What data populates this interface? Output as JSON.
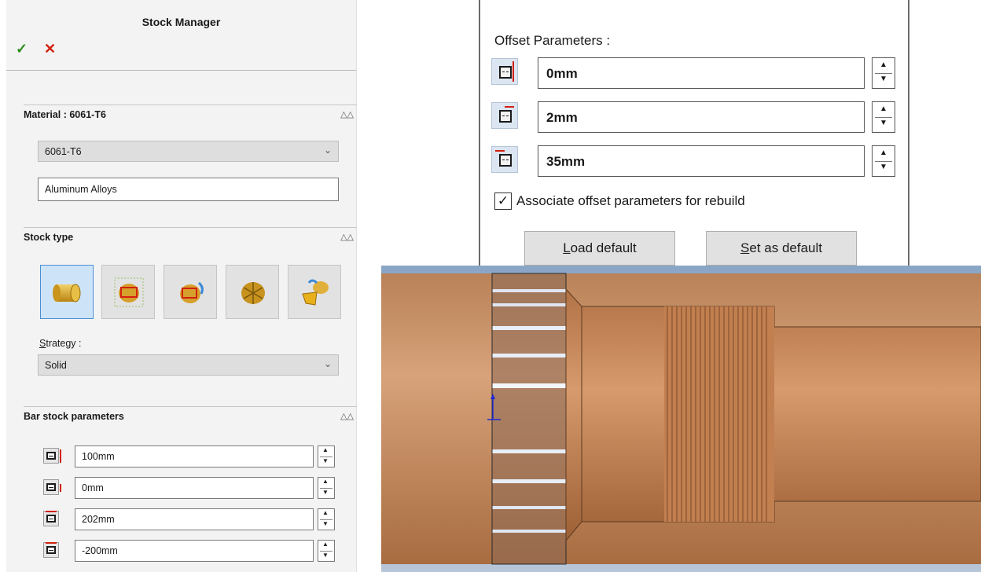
{
  "stock_manager": {
    "title": "Stock Manager",
    "ok_icon": "✓",
    "cancel_icon": "✕",
    "material_section": {
      "heading": "Material : 6061-T6",
      "collapse_icon": "double-chevron-up",
      "material_select": "6061-T6",
      "material_class": "Aluminum Alloys"
    },
    "stock_type_section": {
      "heading": "Stock type",
      "type_buttons": [
        "bar-stock",
        "cast-stock",
        "revolve-stock",
        "stl-stock",
        "part-file-stock"
      ],
      "selected_type": "bar-stock",
      "strategy_label_underline": "S",
      "strategy_label_rest": "trategy :",
      "strategy_value": "Solid"
    },
    "bar_stock_section": {
      "heading": "Bar stock parameters",
      "params": [
        "100mm",
        "0mm",
        "202mm",
        "-200mm"
      ]
    }
  },
  "offset_panel": {
    "title": "Offset Parameters :",
    "params": [
      "0mm",
      "2mm",
      "35mm"
    ],
    "associate_checked": true,
    "associate_label": "Associate offset parameters for rebuild",
    "load_default_underline": "L",
    "load_default_rest": "oad default",
    "set_default_underline": "S",
    "set_default_rest": "et as default"
  },
  "colors": {
    "accept": "#2e8b1f",
    "cancel": "#d3200f",
    "selected": "#cde4f8",
    "stock": "#c98d5f"
  }
}
